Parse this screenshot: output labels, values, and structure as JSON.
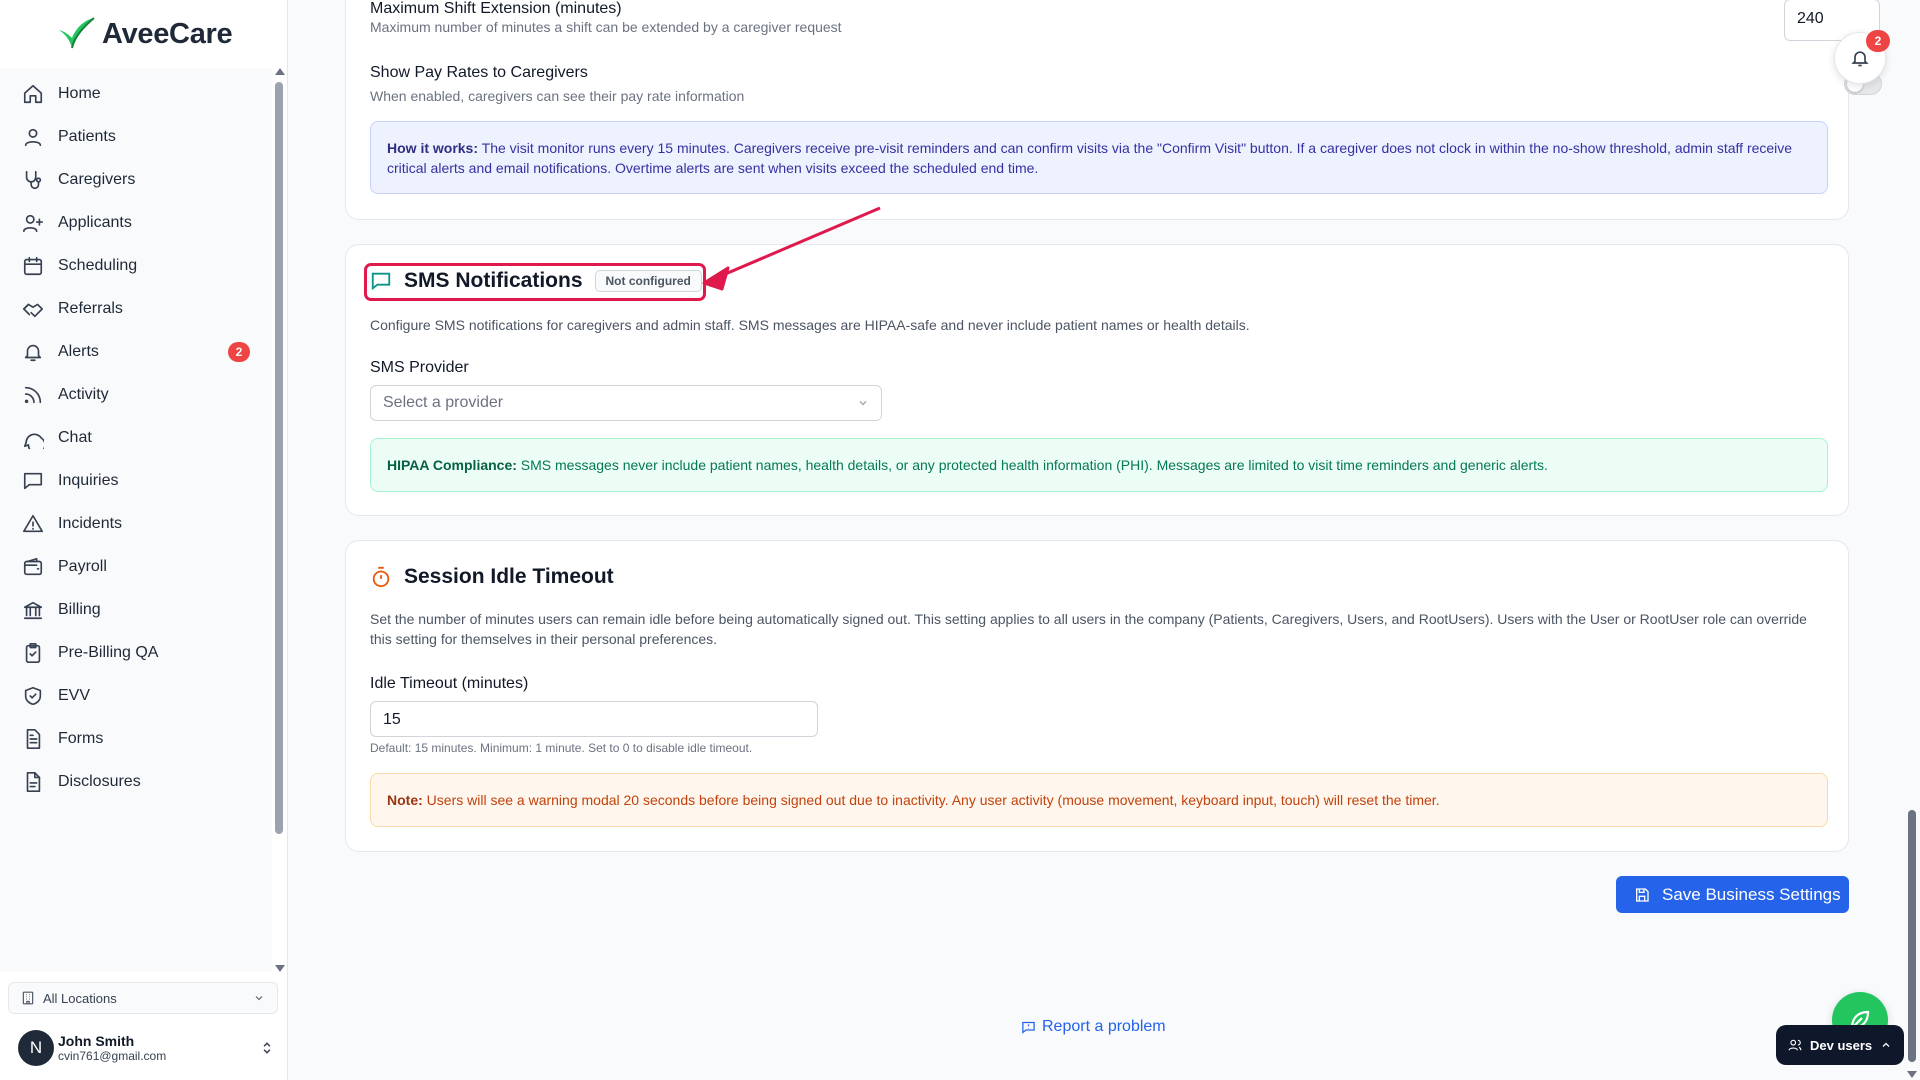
{
  "brand": {
    "name": "AveeCare",
    "accent": "#22c55e"
  },
  "sidebar": {
    "items": [
      {
        "label": "Home",
        "icon": "home-icon"
      },
      {
        "label": "Patients",
        "icon": "user-icon"
      },
      {
        "label": "Caregivers",
        "icon": "stethoscope-icon"
      },
      {
        "label": "Applicants",
        "icon": "user-plus-icon"
      },
      {
        "label": "Scheduling",
        "icon": "calendar-icon"
      },
      {
        "label": "Referrals",
        "icon": "handshake-icon"
      },
      {
        "label": "Alerts",
        "icon": "bell-icon",
        "badge": "2"
      },
      {
        "label": "Activity",
        "icon": "rss-icon"
      },
      {
        "label": "Chat",
        "icon": "chat-bubble-icon"
      },
      {
        "label": "Inquiries",
        "icon": "message-square-icon"
      },
      {
        "label": "Incidents",
        "icon": "warning-triangle-icon"
      },
      {
        "label": "Payroll",
        "icon": "wallet-icon"
      },
      {
        "label": "Billing",
        "icon": "bank-icon"
      },
      {
        "label": "Pre-Billing QA",
        "icon": "clipboard-check-icon"
      },
      {
        "label": "EVV",
        "icon": "shield-check-icon"
      },
      {
        "label": "Forms",
        "icon": "file-text-icon"
      },
      {
        "label": "Disclosures",
        "icon": "document-icon"
      }
    ],
    "location": "All Locations",
    "user": {
      "initial": "N",
      "name": "John Smith",
      "email": "cvin761@gmail.com"
    }
  },
  "visit_settings": {
    "max_extension_title": "Maximum Shift Extension (minutes)",
    "max_extension_desc": "Maximum number of minutes a shift can be extended by a caregiver request",
    "max_extension_value": "240",
    "pay_rates_title": "Show Pay Rates to Caregivers",
    "pay_rates_desc": "When enabled, caregivers can see their pay rate information",
    "pay_rates_enabled": false,
    "info_label": "How it works:",
    "info_text": " The visit monitor runs every 15 minutes. Caregivers receive pre-visit reminders and can confirm visits via the \"Confirm Visit\" button. If a caregiver does not clock in within the no-show threshold, admin staff receive critical alerts and email notifications. Overtime alerts are sent when visits exceed the scheduled end time."
  },
  "sms": {
    "title": "SMS Notifications",
    "status": "Not configured",
    "desc": "Configure SMS notifications for caregivers and admin staff. SMS messages are HIPAA-safe and never include patient names or health details.",
    "provider_label": "SMS Provider",
    "provider_placeholder": "Select a provider",
    "hipaa_label": "HIPAA Compliance:",
    "hipaa_text": " SMS messages never include patient names, health details, or any protected health information (PHI). Messages are limited to visit time reminders and generic alerts."
  },
  "idle": {
    "title": "Session Idle Timeout",
    "desc": "Set the number of minutes users can remain idle before being automatically signed out. This setting applies to all users in the company (Patients, Caregivers, Users, and RootUsers). Users with the User or RootUser role can override this setting for themselves in their personal preferences.",
    "field_label": "Idle Timeout (minutes)",
    "value": "15",
    "hint": "Default: 15 minutes. Minimum: 1 minute. Set to 0 to disable idle timeout.",
    "note_label": "Note:",
    "note_text": " Users will see a warning modal 20 seconds before being signed out due to inactivity. Any user activity (mouse movement, keyboard input, touch) will reset the timer."
  },
  "actions": {
    "save_label": "Save Business Settings",
    "report_label": "Report a problem",
    "dev_users_label": "Dev users",
    "notification_count": "2"
  },
  "colors": {
    "primary": "#2563eb",
    "highlight": "#e0194d",
    "danger": "#ef4444"
  }
}
